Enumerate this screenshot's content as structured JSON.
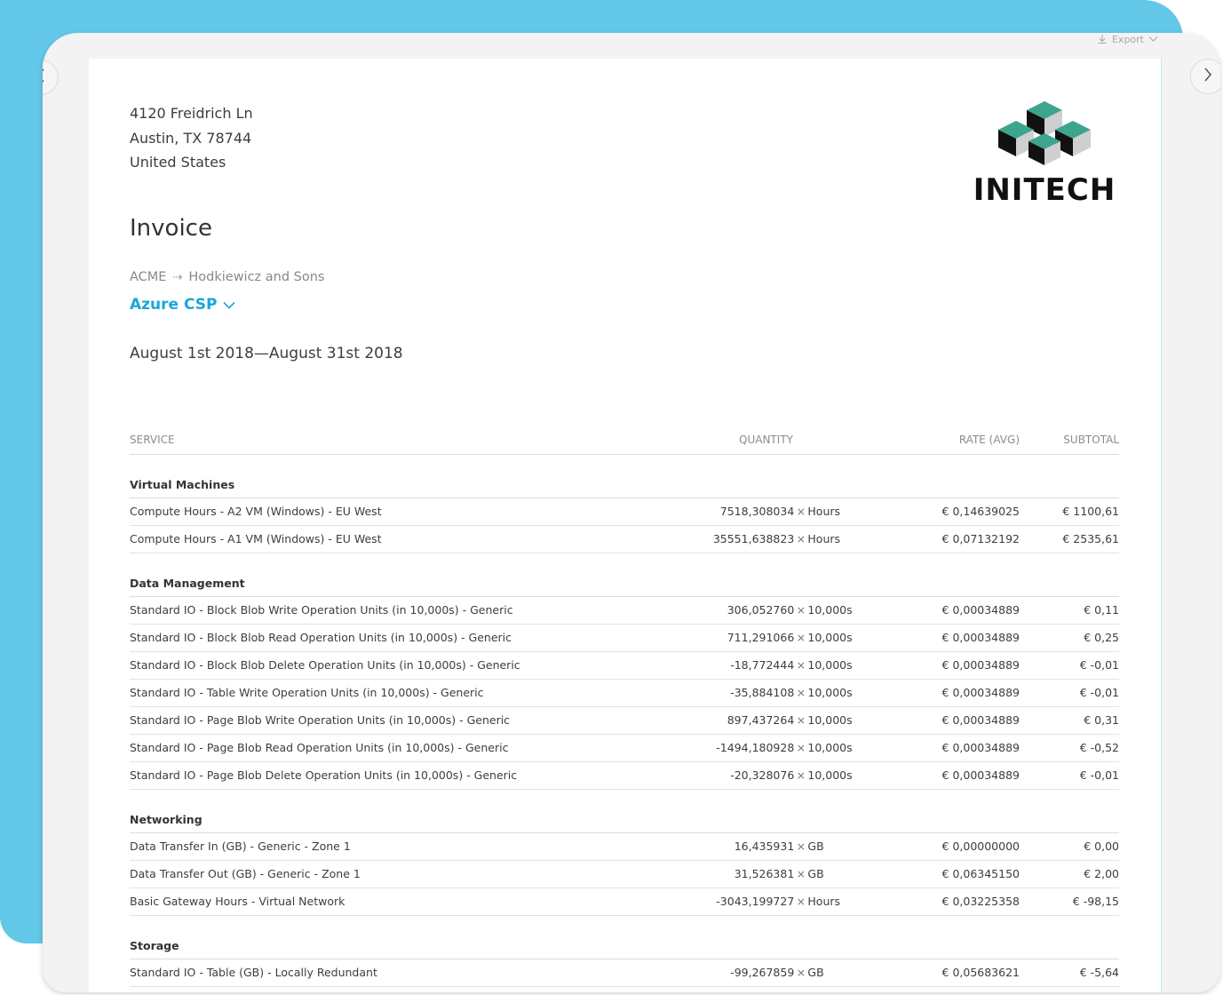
{
  "toolbar": {
    "export_label": "Export"
  },
  "company": {
    "address_line1": "4120 Freidrich Ln",
    "address_line2": "Austin, TX 78744",
    "address_line3": "United States",
    "logo_name": "INITECH"
  },
  "invoice": {
    "title": "Invoice",
    "from": "ACME",
    "to": "Hodkiewicz and Sons",
    "plan": "Azure CSP",
    "period": "August 1st 2018—August 31st 2018"
  },
  "table": {
    "headers": {
      "service": "SERVICE",
      "quantity": "QUANTITY",
      "rate": "RATE (AVG)",
      "subtotal": "SUBTOTAL"
    },
    "groups": [
      {
        "name": "Virtual Machines",
        "rows": [
          {
            "service": "Compute Hours - A2 VM (Windows) - EU West",
            "qty": "7518,308034",
            "unit": "Hours",
            "rate": "€ 0,14639025",
            "subtotal": "€ 1100,61"
          },
          {
            "service": "Compute Hours - A1 VM (Windows) - EU West",
            "qty": "35551,638823",
            "unit": "Hours",
            "rate": "€ 0,07132192",
            "subtotal": "€ 2535,61"
          }
        ]
      },
      {
        "name": "Data Management",
        "rows": [
          {
            "service": "Standard IO - Block Blob Write Operation Units (in 10,000s) - Generic",
            "qty": "306,052760",
            "unit": "10,000s",
            "rate": "€ 0,00034889",
            "subtotal": "€ 0,11"
          },
          {
            "service": "Standard IO - Block Blob Read Operation Units (in 10,000s) - Generic",
            "qty": "711,291066",
            "unit": "10,000s",
            "rate": "€ 0,00034889",
            "subtotal": "€ 0,25"
          },
          {
            "service": "Standard IO - Block Blob Delete Operation Units (in 10,000s) - Generic",
            "qty": "-18,772444",
            "unit": "10,000s",
            "rate": "€ 0,00034889",
            "subtotal": "€ -0,01"
          },
          {
            "service": "Standard IO - Table Write Operation Units (in 10,000s) - Generic",
            "qty": "-35,884108",
            "unit": "10,000s",
            "rate": "€ 0,00034889",
            "subtotal": "€ -0,01"
          },
          {
            "service": "Standard IO - Page Blob Write Operation Units (in 10,000s) - Generic",
            "qty": "897,437264",
            "unit": "10,000s",
            "rate": "€ 0,00034889",
            "subtotal": "€ 0,31"
          },
          {
            "service": "Standard IO - Page Blob Read Operation Units (in 10,000s) - Generic",
            "qty": "-1494,180928",
            "unit": "10,000s",
            "rate": "€ 0,00034889",
            "subtotal": "€ -0,52"
          },
          {
            "service": "Standard IO - Page Blob Delete Operation Units (in 10,000s) - Generic",
            "qty": "-20,328076",
            "unit": "10,000s",
            "rate": "€ 0,00034889",
            "subtotal": "€ -0,01"
          }
        ]
      },
      {
        "name": "Networking",
        "rows": [
          {
            "service": "Data Transfer In (GB) - Generic - Zone 1",
            "qty": "16,435931",
            "unit": "GB",
            "rate": "€ 0,00000000",
            "subtotal": "€ 0,00"
          },
          {
            "service": "Data Transfer Out (GB) - Generic - Zone 1",
            "qty": "31,526381",
            "unit": "GB",
            "rate": "€ 0,06345150",
            "subtotal": "€ 2,00"
          },
          {
            "service": "Basic Gateway Hours - Virtual Network",
            "qty": "-3043,199727",
            "unit": "Hours",
            "rate": "€ 0,03225358",
            "subtotal": "€ -98,15"
          }
        ]
      },
      {
        "name": "Storage",
        "rows": [
          {
            "service": "Standard IO - Table (GB) - Locally Redundant",
            "qty": "-99,267859",
            "unit": "GB",
            "rate": "€ 0,05683621",
            "subtotal": "€ -5,64"
          }
        ]
      }
    ],
    "qty_separator": "×"
  },
  "colors": {
    "accent": "#63c8e8",
    "link": "#1ba6d8"
  }
}
